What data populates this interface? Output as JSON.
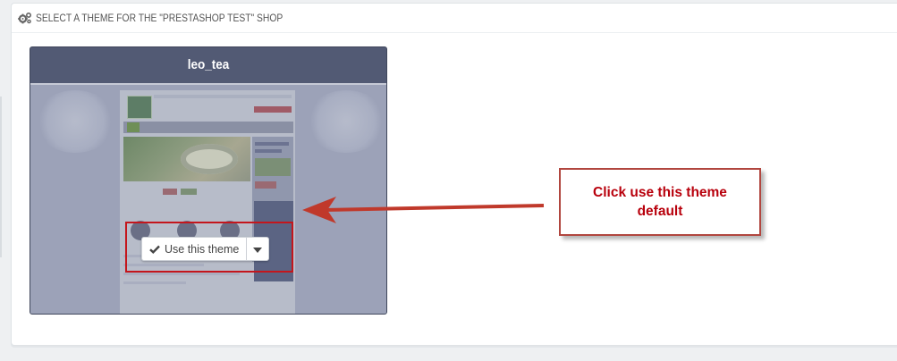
{
  "panel": {
    "heading_icon": "gears-icon",
    "title": "SELECT A THEME FOR THE \"PRESTASHOP TEST\" SHOP"
  },
  "theme": {
    "name": "leo_tea",
    "use_button_label": "Use this theme",
    "use_button_icon": "check-icon",
    "dropdown_icon": "caret-down-icon"
  },
  "annotation": {
    "callout_text": "Click use this theme default",
    "colors": {
      "callout_text": "#b8000c",
      "callout_border": "#b1463f",
      "arrow": "#c0392b",
      "highlight": "#c4161c"
    }
  }
}
